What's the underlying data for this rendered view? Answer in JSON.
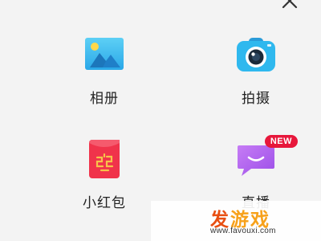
{
  "menu": {
    "items": [
      {
        "label": "相册",
        "icon": "album-icon"
      },
      {
        "label": "拍摄",
        "icon": "camera-icon"
      },
      {
        "label": "小红包",
        "icon": "red-packet-icon"
      },
      {
        "label": "直播",
        "icon": "live-icon",
        "badge": "NEW"
      }
    ]
  },
  "watermark": {
    "brand_primary": "发",
    "brand_secondary": "游戏",
    "url": "www.favouxi.com"
  },
  "colors": {
    "background": "#f3f3f3",
    "badge": "#e7173b",
    "album": "#4cc6f0",
    "camera": "#2fb8ee",
    "red_packet": "#f0334b",
    "live": "#b265f0"
  }
}
